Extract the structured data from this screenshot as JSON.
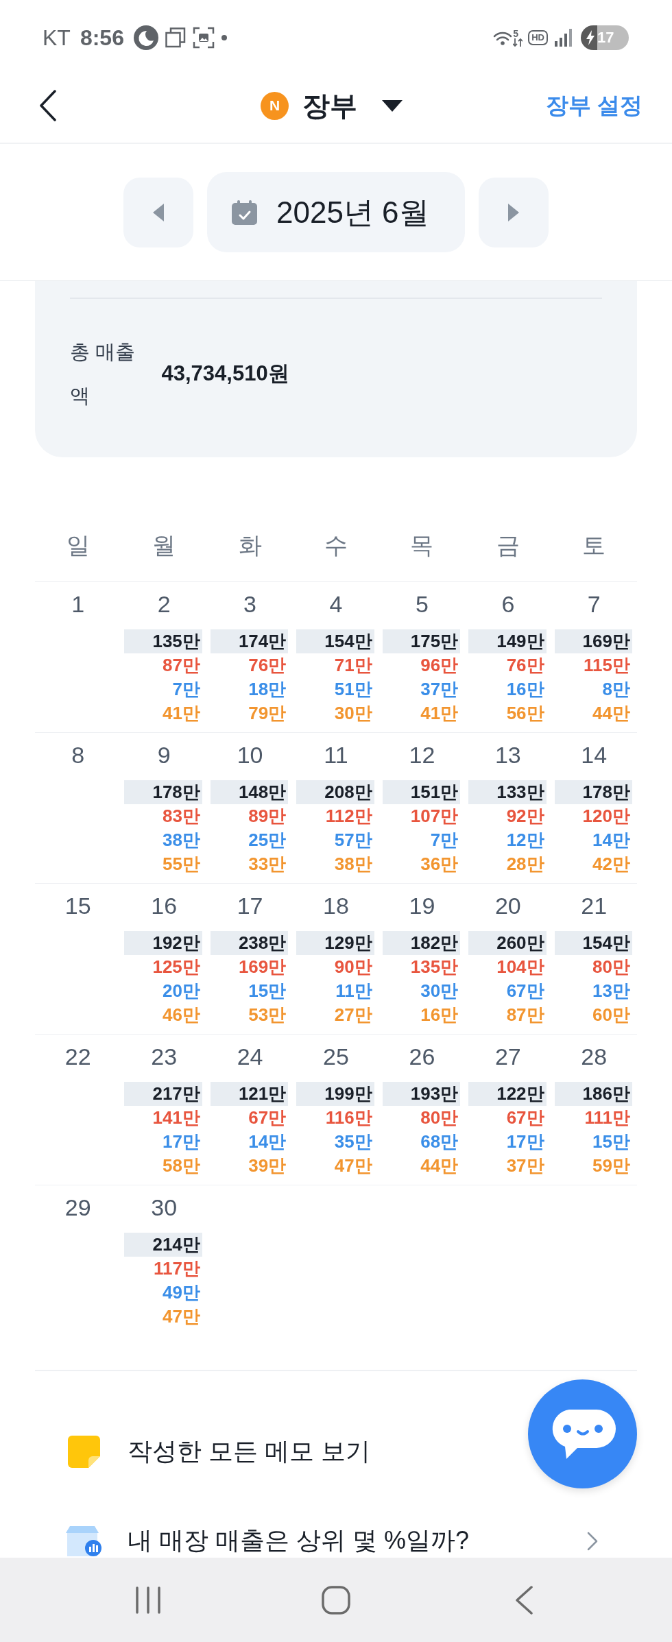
{
  "status_bar": {
    "carrier": "KT",
    "time": "8:56",
    "network": "5",
    "hd": "HD",
    "battery": "17"
  },
  "header": {
    "badge": "N",
    "title": "장부",
    "settings": "장부 설정"
  },
  "month_nav": {
    "label": "2025년 6월"
  },
  "summary": {
    "label": "총 매출액",
    "value": "43,734,510원"
  },
  "weekdays": [
    "일",
    "월",
    "화",
    "수",
    "목",
    "금",
    "토"
  ],
  "weeks": [
    [
      {
        "day": "1"
      },
      {
        "day": "2",
        "amounts": [
          {
            "kind": "total",
            "value": "135만",
            "color": "#191f28"
          },
          {
            "kind": "detail",
            "value": "87만",
            "color": "#e8553e"
          },
          {
            "kind": "detail",
            "value": "7만",
            "color": "#3a8ee8"
          },
          {
            "kind": "detail",
            "value": "41만",
            "color": "#f2952f"
          }
        ]
      },
      {
        "day": "3",
        "amounts": [
          {
            "kind": "total",
            "value": "174만",
            "color": "#191f28"
          },
          {
            "kind": "detail",
            "value": "76만",
            "color": "#e8553e"
          },
          {
            "kind": "detail",
            "value": "18만",
            "color": "#3a8ee8"
          },
          {
            "kind": "detail",
            "value": "79만",
            "color": "#f2952f"
          }
        ]
      },
      {
        "day": "4",
        "amounts": [
          {
            "kind": "total",
            "value": "154만",
            "color": "#191f28"
          },
          {
            "kind": "detail",
            "value": "71만",
            "color": "#e8553e"
          },
          {
            "kind": "detail",
            "value": "51만",
            "color": "#3a8ee8"
          },
          {
            "kind": "detail",
            "value": "30만",
            "color": "#f2952f"
          }
        ]
      },
      {
        "day": "5",
        "amounts": [
          {
            "kind": "total",
            "value": "175만",
            "color": "#191f28"
          },
          {
            "kind": "detail",
            "value": "96만",
            "color": "#e8553e"
          },
          {
            "kind": "detail",
            "value": "37만",
            "color": "#3a8ee8"
          },
          {
            "kind": "detail",
            "value": "41만",
            "color": "#f2952f"
          }
        ]
      },
      {
        "day": "6",
        "amounts": [
          {
            "kind": "total",
            "value": "149만",
            "color": "#191f28"
          },
          {
            "kind": "detail",
            "value": "76만",
            "color": "#e8553e"
          },
          {
            "kind": "detail",
            "value": "16만",
            "color": "#3a8ee8"
          },
          {
            "kind": "detail",
            "value": "56만",
            "color": "#f2952f"
          }
        ]
      },
      {
        "day": "7",
        "amounts": [
          {
            "kind": "total",
            "value": "169만",
            "color": "#191f28"
          },
          {
            "kind": "detail",
            "value": "115만",
            "color": "#e8553e"
          },
          {
            "kind": "detail",
            "value": "8만",
            "color": "#3a8ee8"
          },
          {
            "kind": "detail",
            "value": "44만",
            "color": "#f2952f"
          }
        ]
      }
    ],
    [
      {
        "day": "8"
      },
      {
        "day": "9",
        "amounts": [
          {
            "kind": "total",
            "value": "178만",
            "color": "#191f28"
          },
          {
            "kind": "detail",
            "value": "83만",
            "color": "#e8553e"
          },
          {
            "kind": "detail",
            "value": "38만",
            "color": "#3a8ee8"
          },
          {
            "kind": "detail",
            "value": "55만",
            "color": "#f2952f"
          }
        ]
      },
      {
        "day": "10",
        "amounts": [
          {
            "kind": "total",
            "value": "148만",
            "color": "#191f28"
          },
          {
            "kind": "detail",
            "value": "89만",
            "color": "#e8553e"
          },
          {
            "kind": "detail",
            "value": "25만",
            "color": "#3a8ee8"
          },
          {
            "kind": "detail",
            "value": "33만",
            "color": "#f2952f"
          }
        ]
      },
      {
        "day": "11",
        "amounts": [
          {
            "kind": "total",
            "value": "208만",
            "color": "#191f28"
          },
          {
            "kind": "detail",
            "value": "112만",
            "color": "#e8553e"
          },
          {
            "kind": "detail",
            "value": "57만",
            "color": "#3a8ee8"
          },
          {
            "kind": "detail",
            "value": "38만",
            "color": "#f2952f"
          }
        ]
      },
      {
        "day": "12",
        "amounts": [
          {
            "kind": "total",
            "value": "151만",
            "color": "#191f28"
          },
          {
            "kind": "detail",
            "value": "107만",
            "color": "#e8553e"
          },
          {
            "kind": "detail",
            "value": "7만",
            "color": "#3a8ee8"
          },
          {
            "kind": "detail",
            "value": "36만",
            "color": "#f2952f"
          }
        ]
      },
      {
        "day": "13",
        "amounts": [
          {
            "kind": "total",
            "value": "133만",
            "color": "#191f28"
          },
          {
            "kind": "detail",
            "value": "92만",
            "color": "#e8553e"
          },
          {
            "kind": "detail",
            "value": "12만",
            "color": "#3a8ee8"
          },
          {
            "kind": "detail",
            "value": "28만",
            "color": "#f2952f"
          }
        ]
      },
      {
        "day": "14",
        "amounts": [
          {
            "kind": "total",
            "value": "178만",
            "color": "#191f28"
          },
          {
            "kind": "detail",
            "value": "120만",
            "color": "#e8553e"
          },
          {
            "kind": "detail",
            "value": "14만",
            "color": "#3a8ee8"
          },
          {
            "kind": "detail",
            "value": "42만",
            "color": "#f2952f"
          }
        ]
      }
    ],
    [
      {
        "day": "15"
      },
      {
        "day": "16",
        "amounts": [
          {
            "kind": "total",
            "value": "192만",
            "color": "#191f28"
          },
          {
            "kind": "detail",
            "value": "125만",
            "color": "#e8553e"
          },
          {
            "kind": "detail",
            "value": "20만",
            "color": "#3a8ee8"
          },
          {
            "kind": "detail",
            "value": "46만",
            "color": "#f2952f"
          }
        ]
      },
      {
        "day": "17",
        "amounts": [
          {
            "kind": "total",
            "value": "238만",
            "color": "#191f28"
          },
          {
            "kind": "detail",
            "value": "169만",
            "color": "#e8553e"
          },
          {
            "kind": "detail",
            "value": "15만",
            "color": "#3a8ee8"
          },
          {
            "kind": "detail",
            "value": "53만",
            "color": "#f2952f"
          }
        ]
      },
      {
        "day": "18",
        "amounts": [
          {
            "kind": "total",
            "value": "129만",
            "color": "#191f28"
          },
          {
            "kind": "detail",
            "value": "90만",
            "color": "#e8553e"
          },
          {
            "kind": "detail",
            "value": "11만",
            "color": "#3a8ee8"
          },
          {
            "kind": "detail",
            "value": "27만",
            "color": "#f2952f"
          }
        ]
      },
      {
        "day": "19",
        "amounts": [
          {
            "kind": "total",
            "value": "182만",
            "color": "#191f28"
          },
          {
            "kind": "detail",
            "value": "135만",
            "color": "#e8553e"
          },
          {
            "kind": "detail",
            "value": "30만",
            "color": "#3a8ee8"
          },
          {
            "kind": "detail",
            "value": "16만",
            "color": "#f2952f"
          }
        ]
      },
      {
        "day": "20",
        "amounts": [
          {
            "kind": "total",
            "value": "260만",
            "color": "#191f28"
          },
          {
            "kind": "detail",
            "value": "104만",
            "color": "#e8553e"
          },
          {
            "kind": "detail",
            "value": "67만",
            "color": "#3a8ee8"
          },
          {
            "kind": "detail",
            "value": "87만",
            "color": "#f2952f"
          }
        ]
      },
      {
        "day": "21",
        "amounts": [
          {
            "kind": "total",
            "value": "154만",
            "color": "#191f28"
          },
          {
            "kind": "detail",
            "value": "80만",
            "color": "#e8553e"
          },
          {
            "kind": "detail",
            "value": "13만",
            "color": "#3a8ee8"
          },
          {
            "kind": "detail",
            "value": "60만",
            "color": "#f2952f"
          }
        ]
      }
    ],
    [
      {
        "day": "22"
      },
      {
        "day": "23",
        "amounts": [
          {
            "kind": "total",
            "value": "217만",
            "color": "#191f28"
          },
          {
            "kind": "detail",
            "value": "141만",
            "color": "#e8553e"
          },
          {
            "kind": "detail",
            "value": "17만",
            "color": "#3a8ee8"
          },
          {
            "kind": "detail",
            "value": "58만",
            "color": "#f2952f"
          }
        ]
      },
      {
        "day": "24",
        "amounts": [
          {
            "kind": "total",
            "value": "121만",
            "color": "#191f28"
          },
          {
            "kind": "detail",
            "value": "67만",
            "color": "#e8553e"
          },
          {
            "kind": "detail",
            "value": "14만",
            "color": "#3a8ee8"
          },
          {
            "kind": "detail",
            "value": "39만",
            "color": "#f2952f"
          }
        ]
      },
      {
        "day": "25",
        "amounts": [
          {
            "kind": "total",
            "value": "199만",
            "color": "#191f28"
          },
          {
            "kind": "detail",
            "value": "116만",
            "color": "#e8553e"
          },
          {
            "kind": "detail",
            "value": "35만",
            "color": "#3a8ee8"
          },
          {
            "kind": "detail",
            "value": "47만",
            "color": "#f2952f"
          }
        ]
      },
      {
        "day": "26",
        "amounts": [
          {
            "kind": "total",
            "value": "193만",
            "color": "#191f28"
          },
          {
            "kind": "detail",
            "value": "80만",
            "color": "#e8553e"
          },
          {
            "kind": "detail",
            "value": "68만",
            "color": "#3a8ee8"
          },
          {
            "kind": "detail",
            "value": "44만",
            "color": "#f2952f"
          }
        ]
      },
      {
        "day": "27",
        "amounts": [
          {
            "kind": "total",
            "value": "122만",
            "color": "#191f28"
          },
          {
            "kind": "detail",
            "value": "67만",
            "color": "#e8553e"
          },
          {
            "kind": "detail",
            "value": "17만",
            "color": "#3a8ee8"
          },
          {
            "kind": "detail",
            "value": "37만",
            "color": "#f2952f"
          }
        ]
      },
      {
        "day": "28",
        "amounts": [
          {
            "kind": "total",
            "value": "186만",
            "color": "#191f28"
          },
          {
            "kind": "detail",
            "value": "111만",
            "color": "#e8553e"
          },
          {
            "kind": "detail",
            "value": "15만",
            "color": "#3a8ee8"
          },
          {
            "kind": "detail",
            "value": "59만",
            "color": "#f2952f"
          }
        ]
      }
    ],
    [
      {
        "day": "29"
      },
      {
        "day": "30",
        "amounts": [
          {
            "kind": "total",
            "value": "214만",
            "color": "#191f28"
          },
          {
            "kind": "detail",
            "value": "117만",
            "color": "#e8553e"
          },
          {
            "kind": "detail",
            "value": "49만",
            "color": "#3a8ee8"
          },
          {
            "kind": "detail",
            "value": "47만",
            "color": "#f2952f"
          }
        ]
      }
    ]
  ],
  "menu": [
    {
      "kind": "memo",
      "label": "작성한 모든 메모 보기",
      "arrow": false
    },
    {
      "kind": "ranking",
      "label": "내 매장 매출은 상위 몇 %일까?",
      "arrow": true
    }
  ]
}
